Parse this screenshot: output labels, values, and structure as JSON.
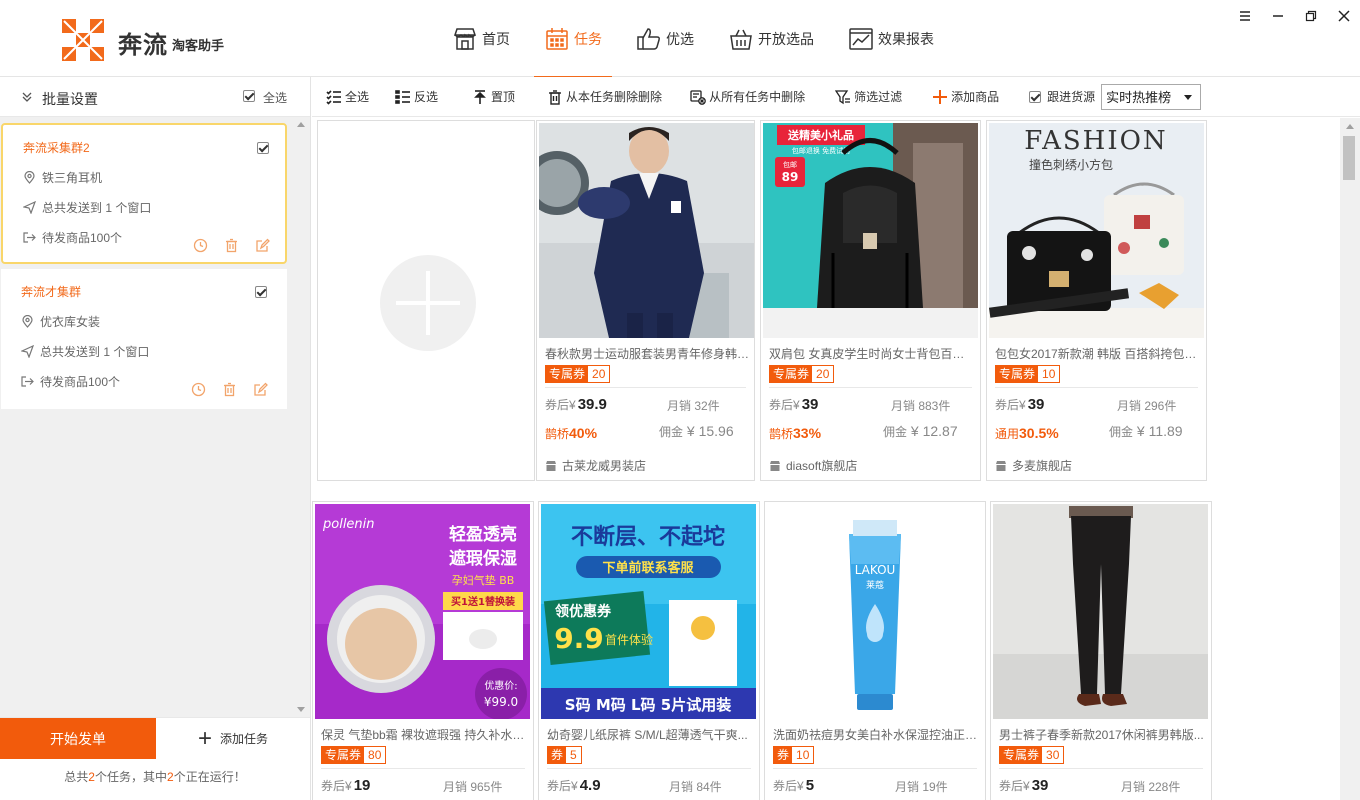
{
  "app": {
    "logo_name": "奔流",
    "logo_sub": "淘客助手",
    "brand_color": "#f26a1b"
  },
  "nav": {
    "items": [
      {
        "label": "首页",
        "icon": "store-icon"
      },
      {
        "label": "任务",
        "icon": "calendar-icon",
        "active": true
      },
      {
        "label": "优选",
        "icon": "thumbs-up-icon"
      },
      {
        "label": "开放选品",
        "icon": "basket-icon"
      },
      {
        "label": "效果报表",
        "icon": "chart-icon"
      }
    ]
  },
  "left": {
    "batch_title": "批量设置",
    "select_all": "全选",
    "tasks": [
      {
        "name": "奔流采集群2",
        "group": "铁三角耳机",
        "sent": "总共发送到 1 个窗口",
        "pending": "待发商品100个",
        "checked": true,
        "selected": true
      },
      {
        "name": "奔流才集群",
        "group": "优衣库女装",
        "sent": "总共发送到 1 个窗口",
        "pending": "待发商品100个",
        "checked": true,
        "selected": false
      }
    ],
    "start_button": "开始发单",
    "add_task_button": "添加任务",
    "footer": {
      "prefix": "总共",
      "total": "2",
      "mid": "个任务，其中",
      "running": "2",
      "suffix": "个正在运行！"
    }
  },
  "toolbar": {
    "select_all": "全选",
    "invert": "反选",
    "top": "置顶",
    "delete_from_task": "从本任务删除删除",
    "delete_from_all": "从所有任务中删除",
    "filter": "筛选过滤",
    "add_product": "添加商品",
    "follow_source": "跟进货源",
    "sort_select": "实时热推榜"
  },
  "products": [
    {
      "title": "春秋款男士运动服套装男青年修身韩版...",
      "coupon_tag": "专属券",
      "coupon": "20",
      "price_label": "券后¥",
      "price": "39.9",
      "sales": "月销 32件",
      "rate_label": "鹊桥",
      "rate": "40%",
      "comm_label": "佣金",
      "commission": "¥ 15.96",
      "shop": "古莱龙威男装店"
    },
    {
      "title": "双肩包 女真皮学生时尚女士背包百搭...",
      "coupon_tag": "专属券",
      "coupon": "20",
      "price_label": "券后¥",
      "price": "39",
      "sales": "月销 883件",
      "rate_label": "鹊桥",
      "rate": "33%",
      "comm_label": "佣金",
      "commission": "¥ 12.87",
      "shop": "diasoft旗舰店"
    },
    {
      "title": "包包女2017新款潮 韩版 百搭斜挎包复...",
      "coupon_tag": "专属券",
      "coupon": "10",
      "price_label": "券后¥",
      "price": "39",
      "sales": "月销 296件",
      "rate_label": "通用",
      "rate": "30.5%",
      "comm_label": "佣金",
      "commission": "¥ 11.89",
      "shop": "多麦旗舰店"
    },
    {
      "title": "保灵 气垫bb霜 裸妆遮瑕强 持久补水保...",
      "coupon_tag": "专属券",
      "coupon": "80",
      "price_label": "券后¥",
      "price": "19",
      "sales": "月销 965件"
    },
    {
      "title": "幼奇婴儿纸尿裤 S/M/L超薄透气干爽...",
      "coupon_tag": "券",
      "coupon": "5",
      "price_label": "券后¥",
      "price": "4.9",
      "sales": "月销 84件"
    },
    {
      "title": "洗面奶祛痘男女美白补水保湿控油正品...",
      "coupon_tag": "券",
      "coupon": "10",
      "price_label": "券后¥",
      "price": "5",
      "sales": "月销 19件"
    },
    {
      "title": "男士裤子春季新款2017休闲裤男韩版...",
      "coupon_tag": "专属券",
      "coupon": "30",
      "price_label": "券后¥",
      "price": "39",
      "sales": "月销 228件"
    }
  ],
  "images": {
    "fashion_head": "FASHION",
    "fashion_sub": "撞色刺绣小方包",
    "bag_ribbon": "送精美小礼品",
    "bag_ribbon_sub": "包邮退换 免费试用",
    "bag_price_tag": "包邮",
    "bag_price": "89",
    "cushion_brand": "pollenin",
    "cushion_l1": "轻盈透亮",
    "cushion_l2": "遮瑕保湿",
    "cushion_l3": "孕妇气垫 BB",
    "cushion_l4": "买1送1替换装",
    "cushion_price_label": "优惠价:",
    "cushion_price": "¥99.0",
    "diaper_l1": "不断层、不起坨",
    "diaper_l2": "下单前联系客服",
    "diaper_l3": "领优惠券",
    "diaper_l4": "9.9",
    "diaper_l5": "首件体验",
    "diaper_l6": "S码 M码 L码 5片试用装",
    "tube_brand": "LAKOU",
    "tube_sub": "莱蔻"
  }
}
